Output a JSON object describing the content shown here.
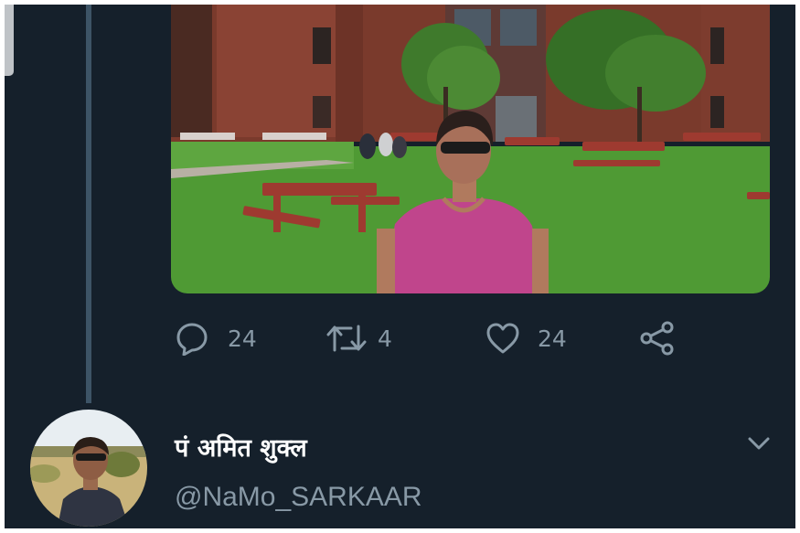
{
  "tweet": {
    "photo": {
      "icon": "photo-image"
    },
    "actions": {
      "reply": {
        "icon": "reply-icon",
        "count": "24"
      },
      "retweet": {
        "icon": "retweet-icon",
        "count": "4"
      },
      "like": {
        "icon": "heart-icon",
        "count": "24"
      },
      "share": {
        "icon": "share-icon"
      }
    }
  },
  "reply": {
    "display_name": "पं अमित शुक्ल",
    "handle": "@NaMo_SARKAAR",
    "menu_icon": "chevron-down-icon"
  },
  "colors": {
    "background": "#15202b",
    "muted_text": "#8899a6",
    "thread_line": "#3d5466",
    "name_text": "#ffffff"
  }
}
